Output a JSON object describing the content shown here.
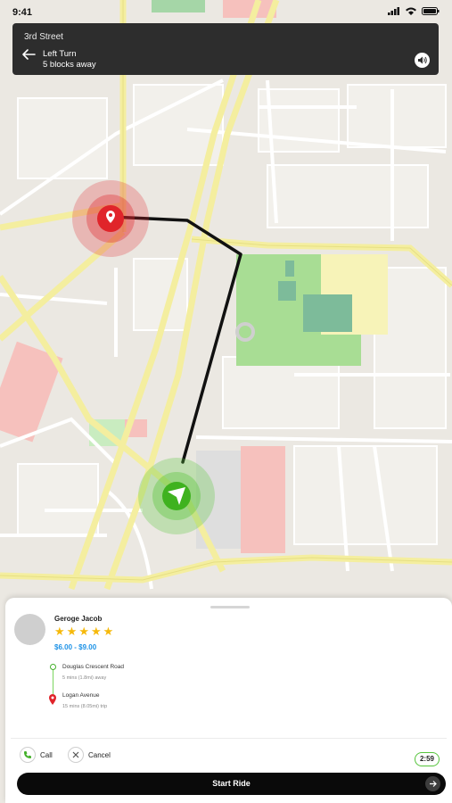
{
  "status_bar": {
    "time": "9:41"
  },
  "navigation": {
    "street": "3rd Street",
    "instruction": "Left Turn",
    "distance": "5 blocks away"
  },
  "driver": {
    "name": "Geroge Jacob",
    "rating": 5,
    "price": "$6.00 - $9.00"
  },
  "route": {
    "pickup": {
      "name": "Douglas Crescent Road",
      "info": "5 mins (1.8mi) away"
    },
    "dropoff": {
      "name": "Logan Avenue",
      "info": "15 mins (8.05mi) trip"
    }
  },
  "actions": {
    "call_label": "Call",
    "cancel_label": "Cancel",
    "timer": "2:59",
    "start_label": "Start Ride"
  },
  "colors": {
    "accent_blue": "#1d92e6",
    "star_yellow": "#f6b90b",
    "route_green": "#43b02a",
    "pin_red": "#e0242a"
  }
}
